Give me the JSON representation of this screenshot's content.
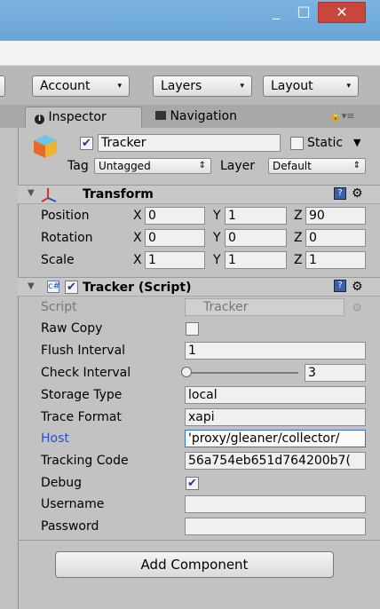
{
  "window": {
    "min_glyph": "_",
    "max_glyph": "□",
    "close_glyph": "✕"
  },
  "toolbar": {
    "account": "Account",
    "layers": "Layers",
    "layout": "Layout",
    "dropdown_glyph": "▾"
  },
  "tabs": {
    "inspector": "Inspector",
    "navigation": "Navigation",
    "lock_glyph": "🔒",
    "menu_glyph": "▾≡"
  },
  "gameobject": {
    "name": "Tracker",
    "active": true,
    "static_label": "Static",
    "tag_label": "Tag",
    "tag_value": "Untagged",
    "layer_label": "Layer",
    "layer_value": "Default"
  },
  "transform": {
    "title": "Transform",
    "rows": [
      {
        "label": "Position",
        "x": "0",
        "y": "1",
        "z": "90"
      },
      {
        "label": "Rotation",
        "x": "0",
        "y": "0",
        "z": "0"
      },
      {
        "label": "Scale",
        "x": "1",
        "y": "1",
        "z": "1"
      }
    ]
  },
  "script": {
    "title": "Tracker (Script)",
    "script_label": "Script",
    "script_value": "Tracker",
    "raw_copy_label": "Raw Copy",
    "flush_label": "Flush Interval",
    "flush_value": "1",
    "check_label": "Check Interval",
    "check_value": "3",
    "check_slider_fraction": 0.0,
    "storage_label": "Storage Type",
    "storage_value": "local",
    "trace_label": "Trace Format",
    "trace_value": "xapi",
    "host_label": "Host",
    "host_value": "'proxy/gleaner/collector/",
    "tracking_label": "Tracking Code",
    "tracking_value": "56a754eb651d764200b7(",
    "debug_label": "Debug",
    "debug_checked": true,
    "username_label": "Username",
    "username_value": "",
    "password_label": "Password",
    "password_value": ""
  },
  "add_component": "Add Component",
  "colors": {
    "titlebar": "#6aa5d6",
    "close": "#c9463d",
    "host_label": "#2a4fc8",
    "panel": "#c2c2c2"
  }
}
